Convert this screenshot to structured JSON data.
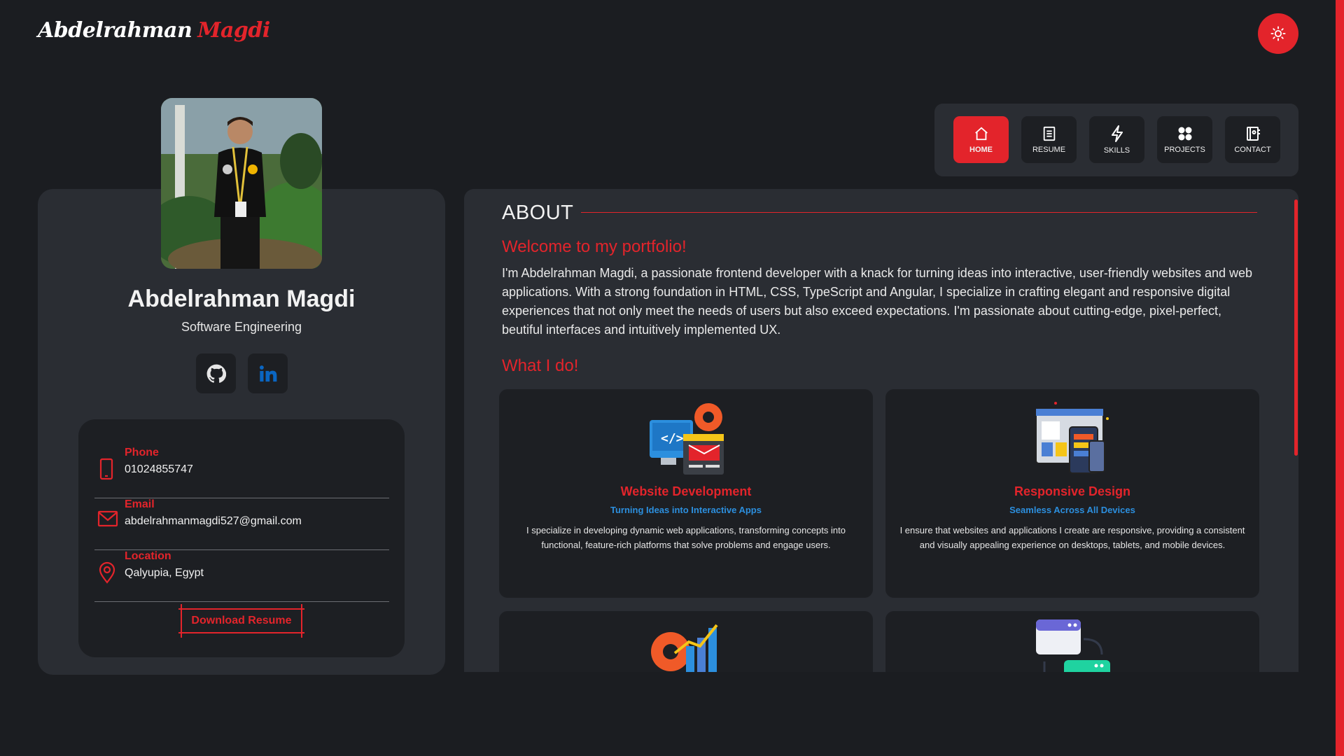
{
  "brand": {
    "first": "Abdelrahman",
    "last": "Magdi",
    "accent": "#e3242b"
  },
  "theme_toggle": {
    "icon": "sun-icon"
  },
  "profile": {
    "name": "Abdelrahman Magdi",
    "role": "Software Engineering",
    "social": [
      {
        "name": "github",
        "icon": "github-icon"
      },
      {
        "name": "linkedin",
        "icon": "linkedin-icon"
      }
    ],
    "contacts": [
      {
        "label": "Phone",
        "value": "01024855747",
        "icon": "phone-icon"
      },
      {
        "label": "Email",
        "value": "abdelrahmanmagdi527@gmail.com",
        "icon": "mail-icon"
      },
      {
        "label": "Location",
        "value": "Qalyupia, Egypt",
        "icon": "location-icon"
      }
    ],
    "download_label": "Download Resume"
  },
  "nav": [
    {
      "label": "HOME",
      "icon": "home-icon",
      "active": true
    },
    {
      "label": "RESUME",
      "icon": "resume-icon",
      "active": false
    },
    {
      "label": "SKILLS",
      "icon": "bolt-icon",
      "active": false
    },
    {
      "label": "PROJECTS",
      "icon": "grid-icon",
      "active": false
    },
    {
      "label": "CONTACT",
      "icon": "contact-book-icon",
      "active": false
    }
  ],
  "about": {
    "title": "ABOUT",
    "welcome": "Welcome to my portfolio!",
    "text": "I'm Abdelrahman Magdi, a passionate frontend developer with a knack for turning ideas into interactive, user-friendly websites and web applications. With a strong foundation in HTML, CSS, TypeScript and Angular, I specialize in crafting elegant and responsive digital experiences that not only meet the needs of users but also exceed expectations. I'm passionate about cutting-edge, pixel-perfect, beutiful interfaces and intuitively implemented UX.",
    "what_i_do": "What I do!"
  },
  "services": [
    {
      "title": "Website Development",
      "subtitle": "Turning Ideas into Interactive Apps",
      "description": "I specialize in developing dynamic web applications, transforming concepts into functional, feature-rich platforms that solve problems and engage users.",
      "icon": "web-development-icon"
    },
    {
      "title": "Responsive Design",
      "subtitle": "Seamless Across All Devices",
      "description": "I ensure that websites and applications I create are responsive, providing a consistent and visually appealing experience on desktops, tablets, and mobile devices.",
      "icon": "responsive-design-icon"
    },
    {
      "title": "",
      "subtitle": "",
      "description": "",
      "icon": "performance-growth-icon"
    },
    {
      "title": "",
      "subtitle": "",
      "description": "",
      "icon": "workflow-icon"
    }
  ]
}
